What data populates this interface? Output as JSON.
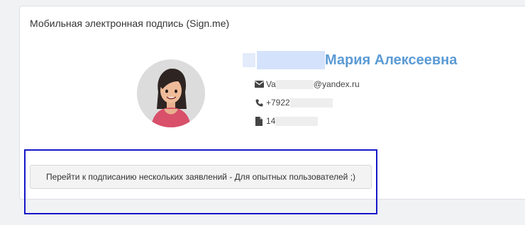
{
  "card": {
    "title": "Мобильная электронная подпись (Sign.me)"
  },
  "profile": {
    "name_visible": "Мария Алексеевна",
    "email_start": "Va",
    "email_end": "@yandex.ru",
    "phone_start": "+7922",
    "doc_start": "14"
  },
  "actions": {
    "multi_sign_label": "Перейти к подписанию нескольких заявлений - Для опытных пользователей ;)"
  },
  "icons": {
    "email": "envelope-icon",
    "phone": "phone-icon",
    "document": "document-icon"
  },
  "colors": {
    "name": "#5b9bd5",
    "highlight_border": "#1717c8"
  }
}
